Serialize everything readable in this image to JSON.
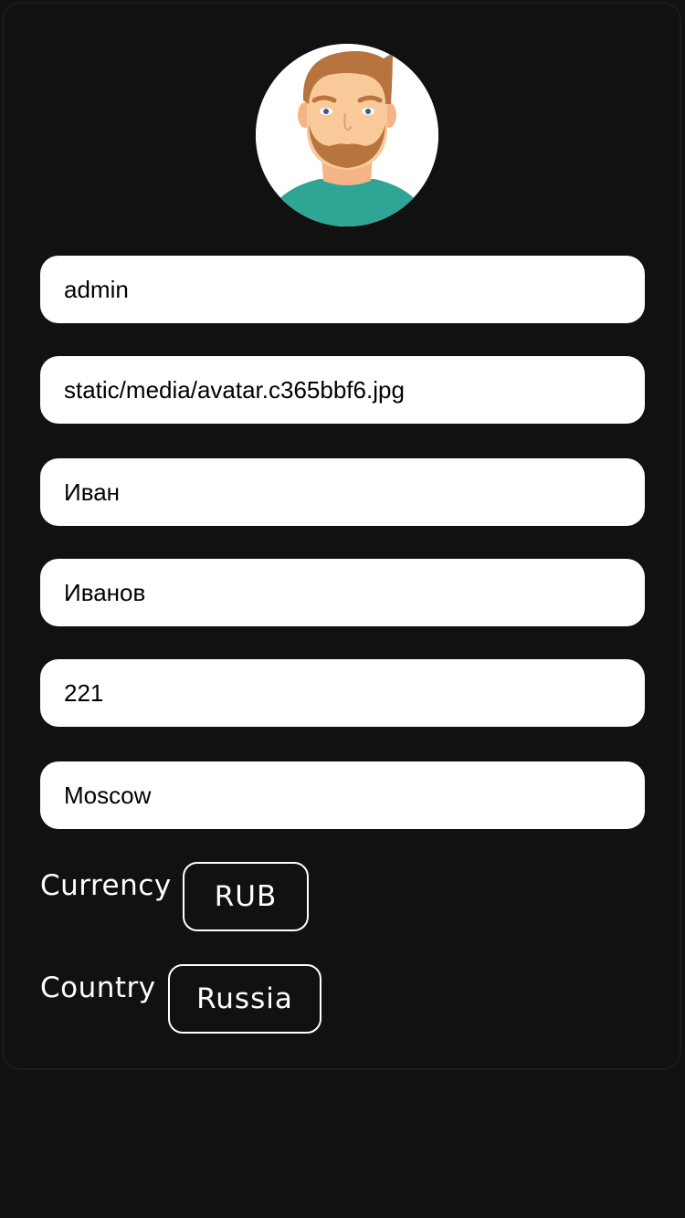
{
  "profile": {
    "avatar_icon": "user-avatar-icon",
    "fields": {
      "username": "admin",
      "avatar_path": "static/media/avatar.c365bbf6.jpg",
      "first_name": "Иван",
      "last_name": "Иванов",
      "number": "221",
      "city": "Moscow"
    },
    "currency": {
      "label": "Currency",
      "value": "RUB"
    },
    "country": {
      "label": "Country",
      "value": "Russia"
    }
  },
  "colors": {
    "background": "#111111",
    "field_background": "#ffffff",
    "shirt": "#2fa596",
    "hair": "#b8743f",
    "skin": "#f9c999"
  }
}
